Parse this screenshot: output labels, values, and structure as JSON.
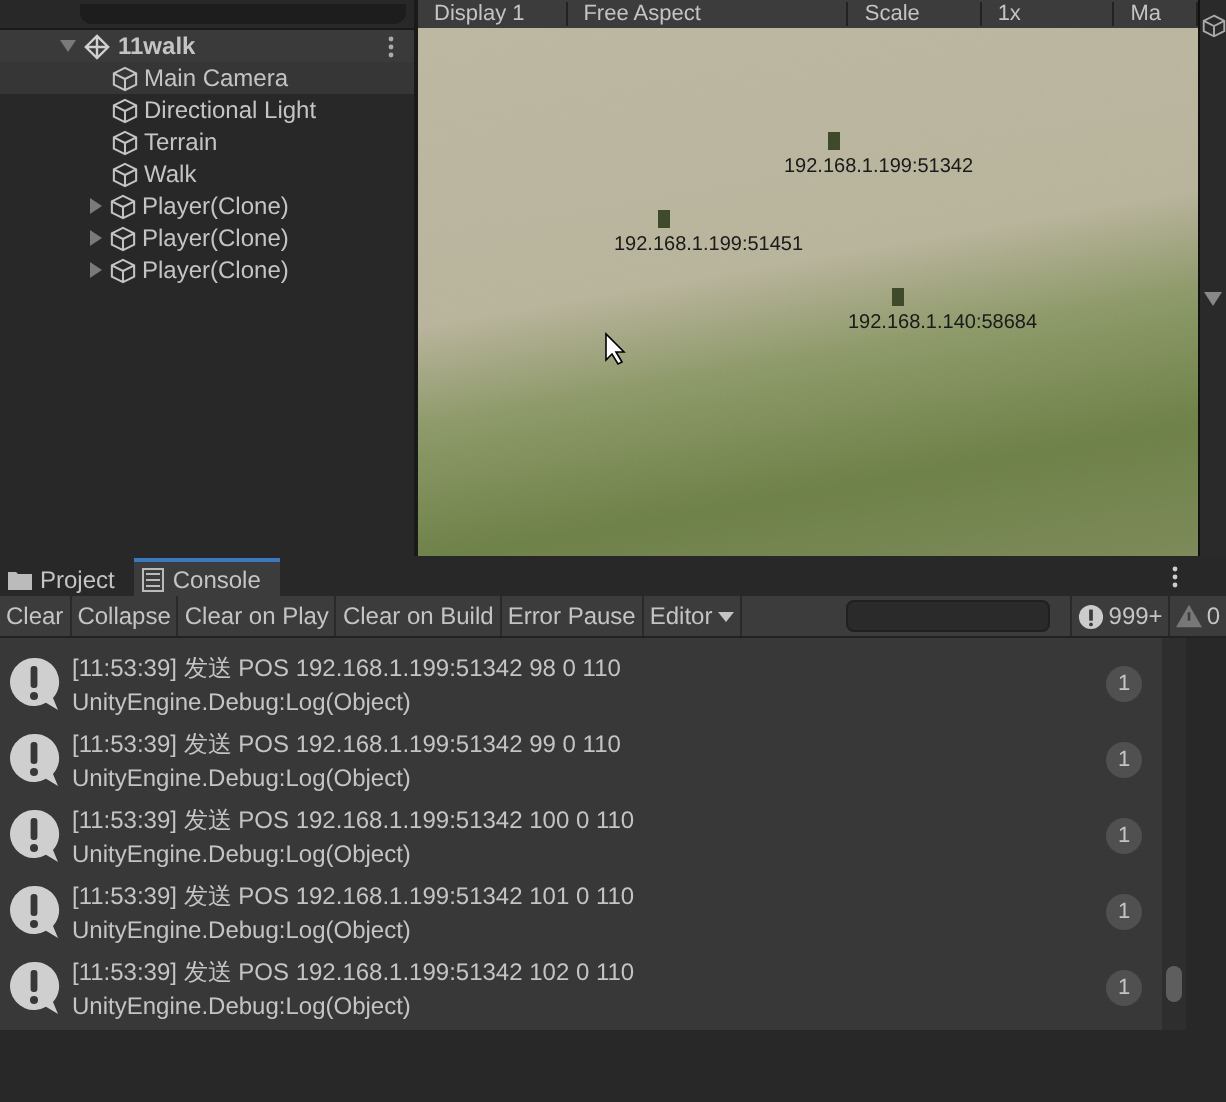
{
  "hierarchy": {
    "scene": {
      "name": "11walk",
      "expanded": true
    },
    "items": [
      {
        "name": "Main Camera",
        "selected": true,
        "expandable": false
      },
      {
        "name": "Directional Light",
        "selected": false,
        "expandable": false
      },
      {
        "name": "Terrain",
        "selected": false,
        "expandable": false
      },
      {
        "name": "Walk",
        "selected": false,
        "expandable": false
      },
      {
        "name": "Player(Clone)",
        "selected": false,
        "expandable": true
      },
      {
        "name": "Player(Clone)",
        "selected": false,
        "expandable": true
      },
      {
        "name": "Player(Clone)",
        "selected": false,
        "expandable": true
      }
    ]
  },
  "game_view": {
    "toolbar": [
      "Display 1",
      "Free Aspect",
      "Scale",
      "1x",
      "Ma"
    ],
    "labels": [
      "192.168.1.199:51342",
      "192.168.1.199:51451",
      "192.168.1.140:58684"
    ]
  },
  "console": {
    "tabs": [
      {
        "label": "Project",
        "selected": false
      },
      {
        "label": "Console",
        "selected": true
      }
    ],
    "toolbar": [
      {
        "label": "Clear",
        "kind": "button"
      },
      {
        "label": "Collapse",
        "kind": "button"
      },
      {
        "label": "Clear on Play",
        "kind": "button"
      },
      {
        "label": "Clear on Build",
        "kind": "button"
      },
      {
        "label": "Error Pause",
        "kind": "button"
      },
      {
        "label": "Editor",
        "kind": "dropdown"
      }
    ],
    "error_count": "999+",
    "warning_count": "0",
    "entries": [
      {
        "message": "[11:53:39] 发送 POS 192.168.1.199:51342 98 0 110",
        "trace": "UnityEngine.Debug:Log(Object)",
        "count": "1"
      },
      {
        "message": "[11:53:39] 发送 POS 192.168.1.199:51342 99 0 110",
        "trace": "UnityEngine.Debug:Log(Object)",
        "count": "1"
      },
      {
        "message": "[11:53:39] 发送 POS 192.168.1.199:51342 100 0 110",
        "trace": "UnityEngine.Debug:Log(Object)",
        "count": "1"
      },
      {
        "message": "[11:53:39] 发送 POS 192.168.1.199:51342 101 0 110",
        "trace": "UnityEngine.Debug:Log(Object)",
        "count": "1"
      },
      {
        "message": "[11:53:39] 发送 POS 192.168.1.199:51342 102 0 110",
        "trace": "UnityEngine.Debug:Log(Object)",
        "count": "1"
      }
    ]
  }
}
